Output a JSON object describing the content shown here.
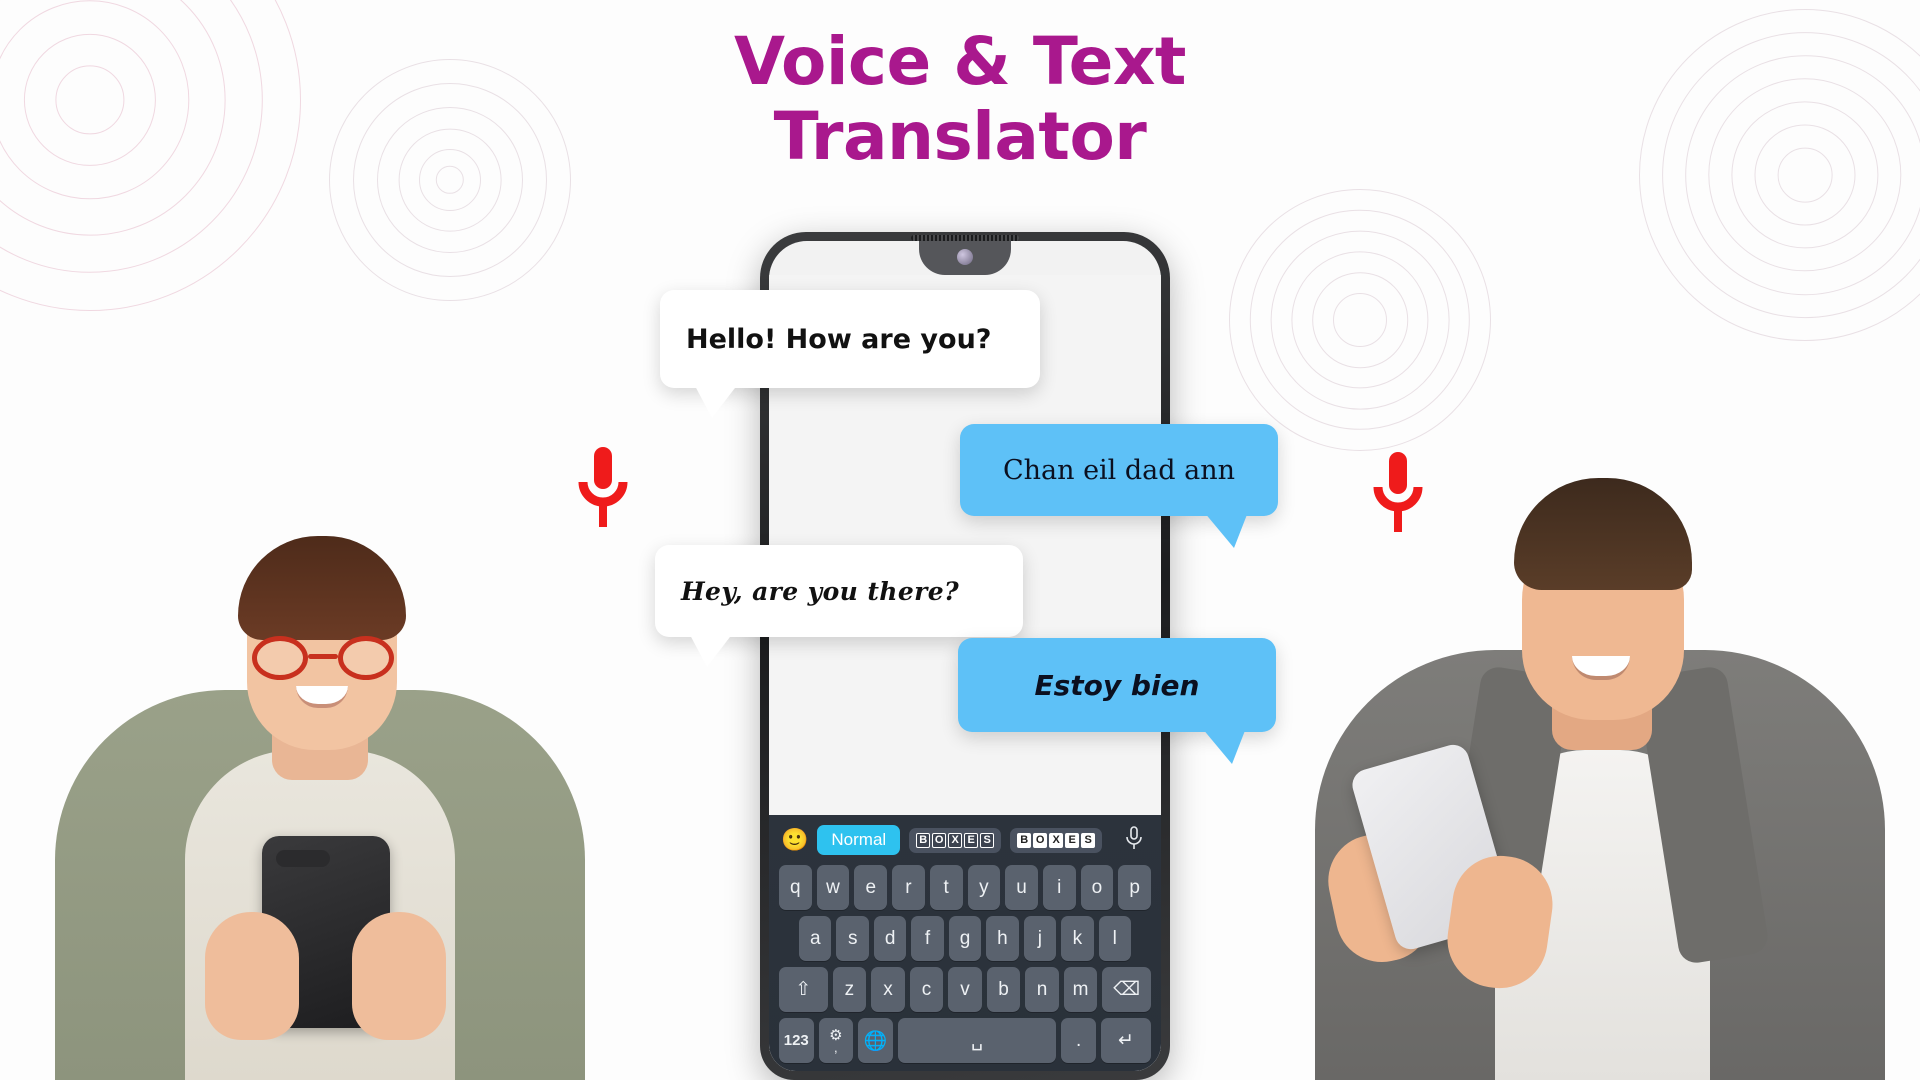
{
  "page": {
    "title_line1": "Voice & Text",
    "title_line2": "Translator",
    "title_color": "#a9188d",
    "background_color": "#ffffff"
  },
  "decor": {
    "ring_groups": [
      "rings-top-left",
      "rings-top-middle",
      "rings-top-right",
      "rings-middle-right"
    ],
    "ring_color": "#d9c3ce"
  },
  "mics": {
    "left_icon": "microphone-icon",
    "right_icon": "microphone-icon",
    "color": "#ef1b1b"
  },
  "people": {
    "left": {
      "name": "woman-with-phone",
      "description": "smiling woman with red glasses holding a phone"
    },
    "right": {
      "name": "man-with-phone",
      "description": "smiling man in grey corduroy jacket holding a phone"
    }
  },
  "bubbles": [
    {
      "id": "bubble-1",
      "text": "Hello! How are you?",
      "style": "white",
      "side": "left"
    },
    {
      "id": "bubble-2",
      "text": "Chan eil dad ann",
      "style": "blue",
      "side": "right"
    },
    {
      "id": "bubble-3",
      "text": "Hey, are you there?",
      "style": "white",
      "side": "left"
    },
    {
      "id": "bubble-4",
      "text": "Estoy bien",
      "style": "blue",
      "side": "right"
    }
  ],
  "bubble_colors": {
    "white": "#ffffff",
    "blue": "#5ec1f7"
  },
  "phone": {
    "device": "android-smartphone-mockup",
    "notch": "waterdrop-notch",
    "camera": "front-camera",
    "speaker": "earpiece-speaker"
  },
  "keyboard": {
    "toolbar": {
      "emoji": "🙂",
      "normal_label": "Normal",
      "normal_color": "#2ec2ef",
      "chip_dark_letters": [
        "B",
        "O",
        "X",
        "E",
        "S"
      ],
      "chip_light_letters": [
        "B",
        "O",
        "X",
        "E",
        "S"
      ],
      "mic_icon": "microphone-icon"
    },
    "rows": [
      [
        "q",
        "w",
        "e",
        "r",
        "t",
        "y",
        "u",
        "i",
        "o",
        "p"
      ],
      [
        "a",
        "s",
        "d",
        "f",
        "g",
        "h",
        "j",
        "k",
        "l"
      ],
      [
        "z",
        "x",
        "c",
        "v",
        "b",
        "n",
        "m"
      ]
    ],
    "shift_label": "⇧",
    "backspace_label": "⌫",
    "numeric_label": "123",
    "settings_label": "⚙",
    "comma_label": ",",
    "globe_label": "🌐",
    "space_label": "␣",
    "period_label": ".",
    "enter_label": "↵",
    "bg_color": "#2c333c",
    "key_color": "#5a626e"
  }
}
